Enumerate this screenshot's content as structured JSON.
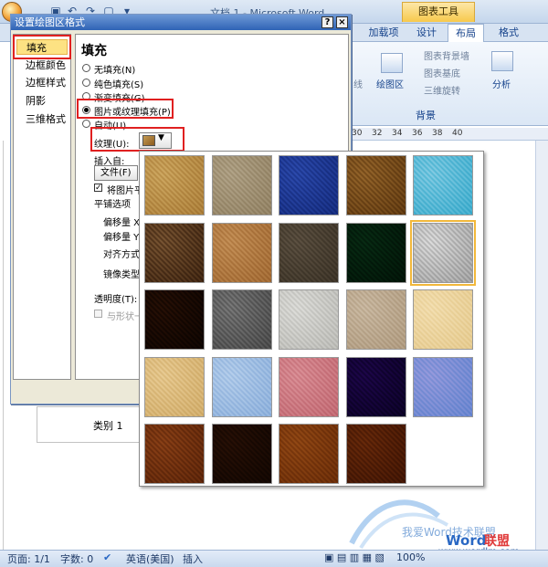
{
  "word": {
    "title": "文档 1 - Microsoft Word",
    "chart_tools": "图表工具",
    "tabs": [
      "加载项",
      "设计",
      "布局",
      "格式"
    ],
    "active_tab": "布局",
    "ribbon": {
      "line_label": "线",
      "plot_area": "绘图区",
      "chart_wall": "图表背景墙",
      "chart_floor": "图表基底",
      "rotation": "三维旋转",
      "analysis": "分析",
      "group": "背景"
    },
    "ruler": [
      "30",
      "32",
      "34",
      "36",
      "38",
      "40"
    ],
    "chart_series": "类别 1",
    "status": {
      "page": "页面: 1/1",
      "words": "字数: 0",
      "lang": "英语(美国)",
      "mode": "插入",
      "zoom": "100%"
    },
    "watermark": "我爱Word技术联盟 Word联盟 www.wordlm.com"
  },
  "dialog": {
    "title": "设置绘图区格式",
    "help_btn": "?",
    "close_btn": "×",
    "nav": [
      "填充",
      "边框颜色",
      "边框样式",
      "阴影",
      "三维格式"
    ],
    "selected_nav": "填充",
    "section": "填充",
    "fill_options": [
      "无填充(N)",
      "纯色填充(S)",
      "渐变填充(G)",
      "图片或纹理填充(P)",
      "自动(U)"
    ],
    "selected_fill": 3,
    "texture_label": "纹理(U):",
    "insert_from": "插入自:",
    "file_btn": "文件(F)",
    "tile_option": "将图片平",
    "tiling_title": "平铺选项",
    "offset_x": "偏移量 X",
    "offset_y": "偏移量 Y",
    "align": "对齐方式",
    "mirror": "镜像类型",
    "transparency": "透明度(T):",
    "rotate_with_shape": "与形状一"
  },
  "gallery": {
    "textures": [
      {
        "name": "papyrus",
        "c1": "#e8d3a3",
        "c2": "#c9a96c"
      },
      {
        "name": "canvas",
        "c1": "#d8d0bf",
        "c2": "#b9ad95"
      },
      {
        "name": "denim",
        "c1": "#6f8ed6",
        "c2": "#3f5fa8"
      },
      {
        "name": "woven-mat",
        "c1": "#c8a66e",
        "c2": "#8f6c35"
      },
      {
        "name": "water-droplets",
        "c1": "#bfe6f2",
        "c2": "#6ccbe0"
      },
      {
        "name": "recycled-paper",
        "c1": "#b69a78",
        "c2": "#6e5134"
      },
      {
        "name": "fish-fossil",
        "c1": "#e3c49b",
        "c2": "#c39a66"
      },
      {
        "name": "sand",
        "c1": "#9e9486",
        "c2": "#716859"
      },
      {
        "name": "green-marble",
        "c1": "#2f6e4a",
        "c2": "#0f3d25"
      },
      {
        "name": "white-marble",
        "c1": "#f2f2f2",
        "c2": "#bdbdbd"
      },
      {
        "name": "brown-marble",
        "c1": "#6b4426",
        "c2": "#2e1a0c"
      },
      {
        "name": "granite",
        "c1": "#b5b5b5",
        "c2": "#7c7c7c"
      },
      {
        "name": "newsprint",
        "c1": "#f0f0ee",
        "c2": "#d3d3d0"
      },
      {
        "name": "parchment",
        "c1": "#e6ddd0",
        "c2": "#cdbfab"
      },
      {
        "name": "cream-paper",
        "c1": "#faf0d8",
        "c2": "#efdfb7"
      },
      {
        "name": "stationery",
        "c1": "#f5e6c6",
        "c2": "#e2cb9a"
      },
      {
        "name": "blue-tissue",
        "c1": "#dbe8f6",
        "c2": "#b4cde9"
      },
      {
        "name": "pink-tissue",
        "c1": "#eec4c8",
        "c2": "#d99aa2"
      },
      {
        "name": "purple-mesh",
        "c1": "#5b2a8f",
        "c2": "#2c0f55"
      },
      {
        "name": "bouquet",
        "c1": "#c9c8ee",
        "c2": "#97b3e3"
      },
      {
        "name": "cork",
        "c1": "#c0844f",
        "c2": "#8d5628"
      },
      {
        "name": "walnut",
        "c1": "#6a4327",
        "c2": "#3a2312"
      },
      {
        "name": "oak",
        "c1": "#c58c4c",
        "c2": "#9a6127"
      },
      {
        "name": "medium-wood",
        "c1": "#a86b35",
        "c2": "#74401a"
      }
    ],
    "selected_index": 9
  }
}
